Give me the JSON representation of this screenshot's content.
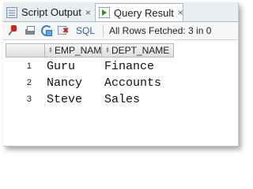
{
  "tabs": [
    {
      "label": "Script Output",
      "icon": "script-output-icon"
    },
    {
      "label": "Query Result",
      "icon": "query-result-icon"
    }
  ],
  "tab_close_glyph": "×",
  "toolbar": {
    "sql_label": "SQL",
    "status": "All Rows Fetched: 3 in 0"
  },
  "grid": {
    "columns": [
      "EMP_NAME",
      "DEPT_NAME"
    ],
    "rows": [
      {
        "num": "1",
        "emp": "Guru",
        "dept": "Finance"
      },
      {
        "num": "2",
        "emp": "Nancy",
        "dept": "Accounts"
      },
      {
        "num": "3",
        "emp": "Steve",
        "dept": "Sales"
      }
    ]
  },
  "colors": {
    "sql_text": "#2b5fa8",
    "close_red": "#d31d1d",
    "tab_strip": "#eaeef3"
  }
}
